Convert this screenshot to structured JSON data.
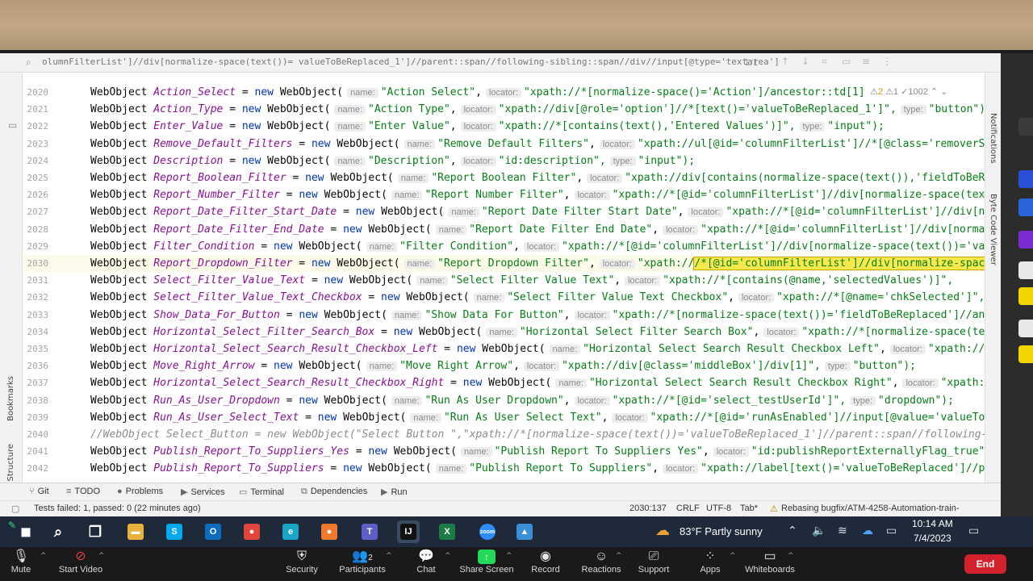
{
  "findbar": {
    "query": "olumnFilterList']//div[normalize-space(text())= valueToBeReplaced_1']//parent::span//following-sibling::span//div//input[@type='textarea']",
    "match_count": "1/1"
  },
  "left_tabs": [
    "Bookmarks",
    "Structure"
  ],
  "right_tabs": [
    "Notifications",
    "Byte Code Viewer"
  ],
  "inspection": {
    "warnings": "2",
    "weak": "1",
    "typos": "1002"
  },
  "lines": [
    {
      "n": "2020",
      "var": "Action_Select",
      "name": "\"Action Select\"",
      "locator": "\"xpath://*[normalize-space()='Action']/ancestor::td[1]"
    },
    {
      "n": "2021",
      "var": "Action_Type",
      "name": "\"Action Type\"",
      "locator": "\"xpath://div[@role='option']//*[text()='valueToBeReplaced_1']\",",
      "type": "\"button\")"
    },
    {
      "n": "2022",
      "var": "Enter_Value",
      "name": "\"Enter Value\"",
      "locator": "\"xpath://*[contains(text(),'Entered Values')]\",",
      "type": "\"input\");"
    },
    {
      "n": "2023",
      "var": "Remove_Default_Filters",
      "name": "\"Remove Default Filters\"",
      "locator": "\"xpath://ul[@id='columnFilterList']//*[@class='removerSm"
    },
    {
      "n": "2024",
      "var": "Description",
      "name": "\"Description\"",
      "locator": "\"id:description\",",
      "type": "\"input\");"
    },
    {
      "n": "2025",
      "var": "Report_Boolean_Filter",
      "name": "\"Report Boolean Filter\"",
      "locator": "\"xpath://div[contains(normalize-space(text()),'fieldToBeRe"
    },
    {
      "n": "2026",
      "var": "Report_Number_Filter",
      "name": "\"Report Number Filter\"",
      "locator": "\"xpath://*[@id='columnFilterList']//div[normalize-space(text"
    },
    {
      "n": "2027",
      "var": "Report_Date_Filter_Start_Date",
      "name": "\"Report Date Filter Start Date\"",
      "locator": "\"xpath://*[@id='columnFilterList']//div[no"
    },
    {
      "n": "2028",
      "var": "Report_Date_Filter_End_Date",
      "name": "\"Report Date Filter End Date\"",
      "locator": "\"xpath://*[@id='columnFilterList']//div[normal"
    },
    {
      "n": "2029",
      "var": "Filter_Condition",
      "name": "\"Filter Condition\"",
      "locator": "\"xpath://*[@id='columnFilterList']//div[normalize-space(text())='val"
    },
    {
      "n": "2030",
      "var": "Report_Dropdown_Filter",
      "name": "\"Report Dropdown Filter\"",
      "locator_pre": "\"xpath://",
      "locator_hl": "/*[@id='columnFilterList']//div[normalize-space(",
      "type_hint_only": true
    },
    {
      "n": "2031",
      "var": "Select_Filter_Value_Text",
      "name": "\"Select Filter Value Text\"",
      "locator": "\"xpath://*[contains(@name,'selectedValues')]\","
    },
    {
      "n": "2032",
      "var": "Select_Filter_Value_Text_Checkbox",
      "name": "\"Select Filter Value Text Checkbox\"",
      "locator": "\"xpath://*[@name='chkSelected']\","
    },
    {
      "n": "2033",
      "var": "Show_Data_For_Button",
      "name": "\"Show Data For Button\"",
      "locator": "\"xpath://*[normalize-space(text())='fieldToBeReplaced']//ance"
    },
    {
      "n": "2034",
      "var": "Horizontal_Select_Filter_Search_Box",
      "name": "\"Horizontal Select Filter Search Box\"",
      "locator": "\"xpath://*[normalize-space(text"
    },
    {
      "n": "2035",
      "var": "Horizontal_Select_Search_Result_Checkbox_Left",
      "name": "\"Horizontal Select Search Result Checkbox Left\"",
      "locator": "\"xpath://in"
    },
    {
      "n": "2036",
      "var": "Move_Right_Arrow",
      "name": "\"Move Right Arrow\"",
      "locator": "\"xpath://div[@class='middleBox']/div[1]\",",
      "type": "\"button\");"
    },
    {
      "n": "2037",
      "var": "Horizontal_Select_Search_Result_Checkbox_Right",
      "name": "\"Horizontal Select Search Result Checkbox Right\"",
      "locator": "\"xpath://"
    },
    {
      "n": "2038",
      "var": "Run_As_User_Dropdown",
      "name": "\"Run As User Dropdown\"",
      "locator": "\"xpath://*[@id='select_testUserId']\",",
      "type": "\"dropdown\");"
    },
    {
      "n": "2039",
      "var": "Run_As_User_Select_Text",
      "name": "\"Run As User Select Text\"",
      "locator": "\"xpath://*[@id='runAsEnabled']//input[@value='valueToBe"
    },
    {
      "n": "2040",
      "comment": "//WebObject Select_Button = new WebObject(\"Select Button \",\"xpath://*[normalize-space(text())='valueToBeReplaced_1']//parent::span//following-s"
    },
    {
      "n": "2041",
      "var": "Publish_Report_To_Suppliers_Yes",
      "name": "\"Publish Report To Suppliers Yes\"",
      "locator": "\"id:publishReportExternallyFlag_true\","
    },
    {
      "n": "2042",
      "var": "Publish_Report_To_Suppliers",
      "name": "\"Publish Report To Suppliers\"",
      "locator": "\"xpath://label[text()='valueToBeReplaced']//pre"
    }
  ],
  "code_tokens": {
    "type_name": "WebObject",
    "assign": " = ",
    "new_kw": "new",
    "ctor_open": "WebObject(",
    "hint_name": "name:",
    "hint_locator": "locator:",
    "hint_type": "type:",
    "comma": ","
  },
  "tool_windows": [
    {
      "icon": "git-icon",
      "label": "Git"
    },
    {
      "icon": "todo-icon",
      "label": "TODO"
    },
    {
      "icon": "problems-icon",
      "label": "Problems"
    },
    {
      "icon": "services-icon",
      "label": "Services"
    },
    {
      "icon": "terminal-icon",
      "label": "Terminal"
    },
    {
      "icon": "dependencies-icon",
      "label": "Dependencies"
    },
    {
      "icon": "run-icon",
      "label": "Run"
    }
  ],
  "status": {
    "tests": "Tests failed: 1, passed: 0 (22 minutes ago)",
    "position": "2030:137",
    "line_sep": "CRLF",
    "encoding": "UTF-8",
    "indent": "Tab*",
    "vcs": "Rebasing bugfix/ATM-4258-Automation-train-"
  },
  "taskbar": {
    "weather": "83°F  Partly sunny",
    "time": "10:14 AM",
    "date": "7/4/2023",
    "apps": [
      {
        "name": "taskbar-search",
        "glyph": "⌕",
        "bg": "transparent"
      },
      {
        "name": "taskbar-task-view",
        "glyph": "❐",
        "bg": "transparent"
      },
      {
        "name": "taskbar-file-explorer",
        "glyph": "▬",
        "bg": "#e8b13c"
      },
      {
        "name": "taskbar-skype",
        "glyph": "S",
        "bg": "#00a9f0"
      },
      {
        "name": "taskbar-outlook",
        "glyph": "O",
        "bg": "#0f6cbd"
      },
      {
        "name": "taskbar-chrome",
        "glyph": "●",
        "bg": "#e0463b"
      },
      {
        "name": "taskbar-edge",
        "glyph": "e",
        "bg": "#1aa5c9"
      },
      {
        "name": "taskbar-firefox",
        "glyph": "●",
        "bg": "#f2772f"
      },
      {
        "name": "taskbar-teams",
        "glyph": "T",
        "bg": "#5b5fc7"
      },
      {
        "name": "taskbar-intellij",
        "glyph": "IJ",
        "bg": "#111111"
      },
      {
        "name": "taskbar-excel",
        "glyph": "X",
        "bg": "#1d7b45"
      },
      {
        "name": "taskbar-zoom",
        "glyph": "zoom",
        "bg": "#2d8cff"
      },
      {
        "name": "taskbar-remote",
        "glyph": "▲",
        "bg": "#3a8fd8"
      }
    ]
  },
  "zoom": {
    "mute": "Mute",
    "video": "Start Video",
    "security": "Security",
    "participants": "Participants",
    "participants_count": "2",
    "chat": "Chat",
    "share": "Share Screen",
    "record": "Record",
    "reactions": "Reactions",
    "support": "Support",
    "apps": "Apps",
    "whiteboards": "Whiteboards",
    "end": "End"
  }
}
